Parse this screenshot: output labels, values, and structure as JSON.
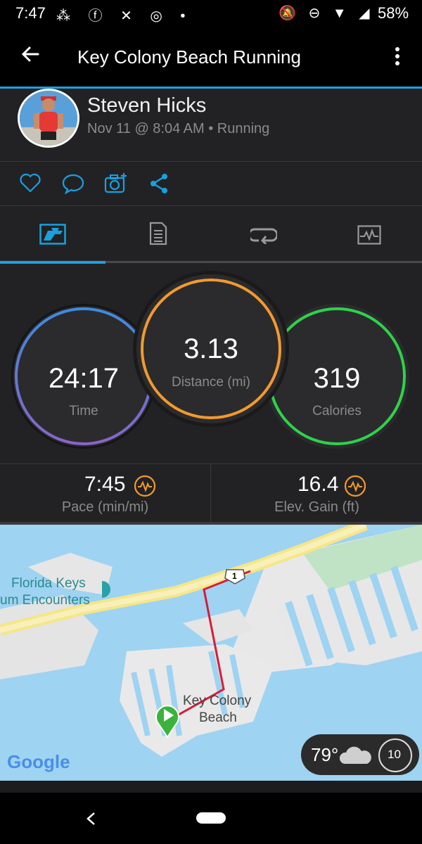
{
  "status_bar": {
    "time": "7:47",
    "battery": "58%"
  },
  "app_bar": {
    "title": "Key Colony Beach Running",
    "back_icon": "arrow-left-icon",
    "menu_icon": "more-vert-icon"
  },
  "activity": {
    "user_name": "Steven Hicks",
    "subtitle": "Nov 11 @ 8:04 AM • Running"
  },
  "actions": [
    "like-icon",
    "comment-icon",
    "add-photo-icon",
    "share-icon"
  ],
  "tabs": [
    "stats-icon",
    "details-icon",
    "laps-icon",
    "charts-icon"
  ],
  "stats": {
    "time": {
      "value": "24:17",
      "label": "Time"
    },
    "distance": {
      "value": "3.13",
      "label": "Distance (mi)"
    },
    "calories": {
      "value": "319",
      "label": "Calories"
    }
  },
  "metrics": {
    "pace": {
      "value": "7:45",
      "label": "Pace (min/mi)"
    },
    "elevation": {
      "value": "16.4",
      "label": "Elev. Gain (ft)"
    }
  },
  "map": {
    "label_line1": "Florida Keys",
    "label_line2": "um Encounters",
    "place_line1": "Key Colony",
    "place_line2": "Beach",
    "route_badge": "1",
    "logo": "Google"
  },
  "weather": {
    "temp": "79°",
    "wind": "10"
  },
  "colors": {
    "accent": "#1aa0de",
    "time_ring": "#7c6fd0",
    "distance_ring": "#f29a2e",
    "calories_ring": "#2ed24a",
    "route": "#d81b3b"
  }
}
